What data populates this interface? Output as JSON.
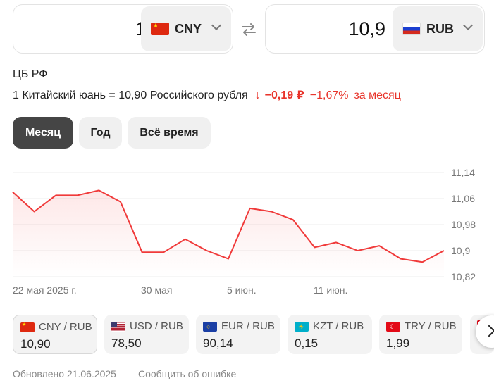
{
  "converter": {
    "from": {
      "amount": "1",
      "code": "CNY",
      "flag": "china-flag"
    },
    "to": {
      "amount": "10,9",
      "code": "RUB",
      "flag": "russia-flag"
    },
    "swap_icon": "swap-arrows-icon"
  },
  "source": "ЦБ РФ",
  "rate": {
    "text": "1 Китайский юань = 10,90 Российского рубля",
    "change_abs": "−0,19 ₽",
    "change_pct": "−1,67%",
    "change_period": "за месяц",
    "down_color": "#e8332a"
  },
  "tabs": [
    {
      "label": "Месяц",
      "active": true
    },
    {
      "label": "Год",
      "active": false
    },
    {
      "label": "Всё время",
      "active": false
    }
  ],
  "chart_data": {
    "type": "line",
    "y_ticks": [
      "11,14",
      "11,06",
      "10,98",
      "10,9",
      "10,82"
    ],
    "x_ticks": [
      "22 мая 2025 г.",
      "30 мая",
      "5 июн.",
      "11 июн."
    ],
    "ylim": [
      10.82,
      11.14
    ],
    "grid": true,
    "line_color": "#f03a3a",
    "values": [
      11.08,
      11.02,
      11.07,
      11.07,
      11.085,
      11.05,
      10.895,
      10.895,
      10.935,
      10.9,
      10.875,
      11.03,
      11.02,
      10.995,
      10.91,
      10.925,
      10.9,
      10.915,
      10.875,
      10.865,
      10.9
    ]
  },
  "pairs": [
    {
      "label": "CNY / RUB",
      "value": "10,90",
      "flag": "china-flag"
    },
    {
      "label": "USD / RUB",
      "value": "78,50",
      "flag": "usa-flag"
    },
    {
      "label": "EUR / RUB",
      "value": "90,14",
      "flag": "eu-flag"
    },
    {
      "label": "KZT / RUB",
      "value": "0,15",
      "flag": "kazakhstan-flag"
    },
    {
      "label": "TRY / RUB",
      "value": "1,99",
      "flag": "turkey-flag"
    }
  ],
  "footer": {
    "updated": "Обновлено 21.06.2025",
    "report": "Сообщить об ошибке"
  }
}
